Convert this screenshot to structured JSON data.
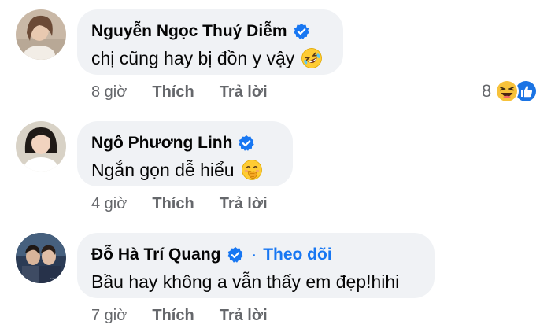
{
  "comments": [
    {
      "author": "Nguyễn Ngọc Thuý Diễm",
      "text": "chị cũng hay bị đồn y vậy",
      "emoji": "rolling-on-floor-laughing",
      "time": "8 giờ",
      "like_label": "Thích",
      "reply_label": "Trả lời",
      "reaction_count": "8"
    },
    {
      "author": "Ngô Phương Linh",
      "text": "Ngắn gọn dễ hiểu",
      "emoji": "hand-over-mouth",
      "time": "4 giờ",
      "like_label": "Thích",
      "reply_label": "Trả lời"
    },
    {
      "author": "Đỗ Hà Trí Quang",
      "follow_label": "Theo dõi",
      "text": "Bầu hay không a vẫn thấy em đẹp!hihi",
      "time": "7 giờ",
      "like_label": "Thích",
      "reply_label": "Trả lời"
    }
  ],
  "colors": {
    "bubble": "#f0f2f5",
    "accent": "#1877f2",
    "meta": "#65676b"
  }
}
